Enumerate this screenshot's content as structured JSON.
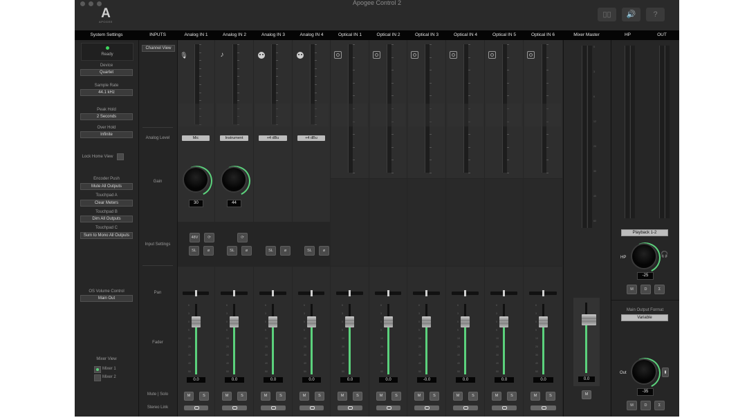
{
  "window": {
    "title": "Apogee Control 2"
  },
  "logo": {
    "letter": "A",
    "word": "APOGEE"
  },
  "toolbar": {
    "btn1": "▯▯",
    "btn2": "🔊",
    "btn3": "?"
  },
  "headers": [
    "System Settings",
    "INPUTS",
    "Analog IN 1",
    "Analog IN 2",
    "Analog IN 3",
    "Analog IN 4",
    "Optical IN 1",
    "Optical IN 2",
    "Optical IN 3",
    "Optical IN 4",
    "Optical IN 5",
    "Optical IN 6",
    "Mixer Master",
    "HP",
    "OUT"
  ],
  "system": {
    "status": "Ready",
    "device_label": "Device",
    "device_value": "Quartet",
    "sample_rate_label": "Sample Rate",
    "sample_rate_value": "44.1 kHz",
    "peak_hold_label": "Peak Hold",
    "peak_hold_value": "2 Seconds",
    "over_hold_label": "Over Hold",
    "over_hold_value": "Infinite",
    "lock_label": "Lock Home View",
    "encoder_label": "Encoder Push",
    "encoder_value": "Mute All Outputs",
    "touchpad_a_label": "Touchpad A",
    "touchpad_a_value": "Clear Meters",
    "touchpad_b_label": "Touchpad B",
    "touchpad_b_value": "Dim All Outputs",
    "touchpad_c_label": "Touchpad C",
    "touchpad_c_value": "Sum to Mono All Outputs",
    "os_volume_label": "OS Volume Control",
    "os_volume_value": "Main Out",
    "mixer_view_label": "Mixer View",
    "mixer1": "Mixer 1",
    "mixer2": "Mixer 2"
  },
  "inputs": {
    "channel_view": "Channel View",
    "analog_level": "Analog Level",
    "gain": "Gain",
    "input_settings": "Input Settings",
    "pan": "Pan",
    "fader": "Fader",
    "mute_solo": "Mute | Solo",
    "stereo_link": "Stereo Link"
  },
  "channels": [
    {
      "icon": "mic-icon",
      "level": "Mic",
      "gain": "30",
      "fader": "0.0",
      "p48": "48V",
      "extra": "⟳",
      "sl": "SL",
      "phase": "ø"
    },
    {
      "icon": "guitar-icon",
      "level": "Instrument",
      "gain": "44",
      "fader": "0.0",
      "extra": "⟳",
      "sl": "SL",
      "phase": "ø"
    },
    {
      "icon": "xlr-icon",
      "level": "+4 dBu",
      "fader": "0.0",
      "sl": "SL",
      "phase": "ø"
    },
    {
      "icon": "xlr-icon",
      "level": "+4 dBu",
      "fader": "0.0",
      "sl": "SL",
      "phase": "ø"
    },
    {
      "icon": "optical-icon",
      "fader": "0.0"
    },
    {
      "icon": "optical-icon",
      "fader": "0.0"
    },
    {
      "icon": "optical-icon",
      "fader": "-0.0"
    },
    {
      "icon": "optical-icon",
      "fader": "0.0"
    },
    {
      "icon": "optical-icon",
      "fader": "0.0"
    },
    {
      "icon": "optical-icon",
      "fader": "0.0"
    }
  ],
  "buttons": {
    "mute": "M",
    "solo": "S"
  },
  "master": {
    "fader": "0.0",
    "mute": "M"
  },
  "hp": {
    "source": "Playback 1-2",
    "label": "HP",
    "value": "-25",
    "m": "M",
    "d": "D",
    "sum": "Σ"
  },
  "out": {
    "format_label": "Main Output Format",
    "format_value": "Variable",
    "label": "Out",
    "value": "-35",
    "m": "M",
    "d": "D",
    "sum": "Σ"
  },
  "fader_scale": [
    "6",
    "3",
    "0",
    "5",
    "10",
    "20",
    "30",
    "40",
    "50"
  ],
  "meter_scale": [
    "0",
    "3",
    "6",
    "12",
    "20",
    "30",
    "40",
    "60"
  ]
}
